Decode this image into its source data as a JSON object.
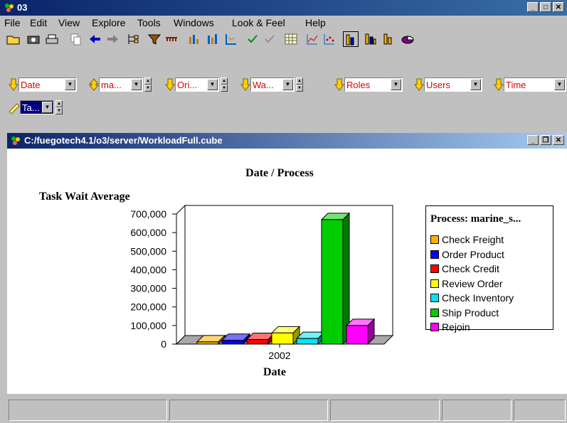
{
  "app": {
    "title": "03"
  },
  "menu": [
    "File",
    "Edit",
    "View",
    "Explore",
    "Tools",
    "Windows",
    "Look & Feel",
    "Help"
  ],
  "toolbar": {
    "icons": [
      "open-folder-icon",
      "camera-icon",
      "print-icon",
      "copy-icon",
      "back-arrow-icon",
      "forward-arrow-icon",
      "hierarchy-icon",
      "filter-icon",
      "scale-icon",
      "bar-chart-icon",
      "grouped-bar-icon",
      "axis-icon",
      "check-icon",
      "uncheck-icon",
      "grid-icon",
      "line-chart-icon",
      "scatter-icon",
      "bar3d-icon",
      "stacked-bar3d-icon",
      "bar3d-alt-icon",
      "pie-icon"
    ]
  },
  "dimensions": [
    {
      "label": "Date"
    },
    {
      "label": "ma..."
    },
    {
      "label": "Ori..."
    },
    {
      "label": "Wa..."
    },
    {
      "label": "Roles"
    },
    {
      "label": "Users"
    },
    {
      "label": "Time"
    },
    {
      "label": "Ta..."
    }
  ],
  "inner_window": {
    "title": "C:/fuegotech4.1/o3/server/WorkloadFull.cube"
  },
  "legend": {
    "title": "Process: marine_s..."
  },
  "chart_data": {
    "type": "bar",
    "title": "Date / Process",
    "ylabel": "Task Wait Average",
    "xlabel": "Date",
    "categories": [
      "2002"
    ],
    "ylim": [
      0,
      700000
    ],
    "yticks": [
      "700,000",
      "600,000",
      "500,000",
      "400,000",
      "300,000",
      "200,000",
      "100,000",
      "0"
    ],
    "series": [
      {
        "name": "Check Freight",
        "values": [
          12000
        ],
        "color": "#ffb000"
      },
      {
        "name": "Order Product",
        "values": [
          20000
        ],
        "color": "#0000ff"
      },
      {
        "name": "Check Credit",
        "values": [
          25000
        ],
        "color": "#ff0000"
      },
      {
        "name": "Review Order",
        "values": [
          60000
        ],
        "color": "#ffff00"
      },
      {
        "name": "Check Inventory",
        "values": [
          30000
        ],
        "color": "#00e5ee"
      },
      {
        "name": "Ship Product",
        "values": [
          670000
        ],
        "color": "#00cc00"
      },
      {
        "name": "Rejoin",
        "values": [
          100000
        ],
        "color": "#ff00ff"
      }
    ],
    "grid": false,
    "legend_position": "right"
  }
}
